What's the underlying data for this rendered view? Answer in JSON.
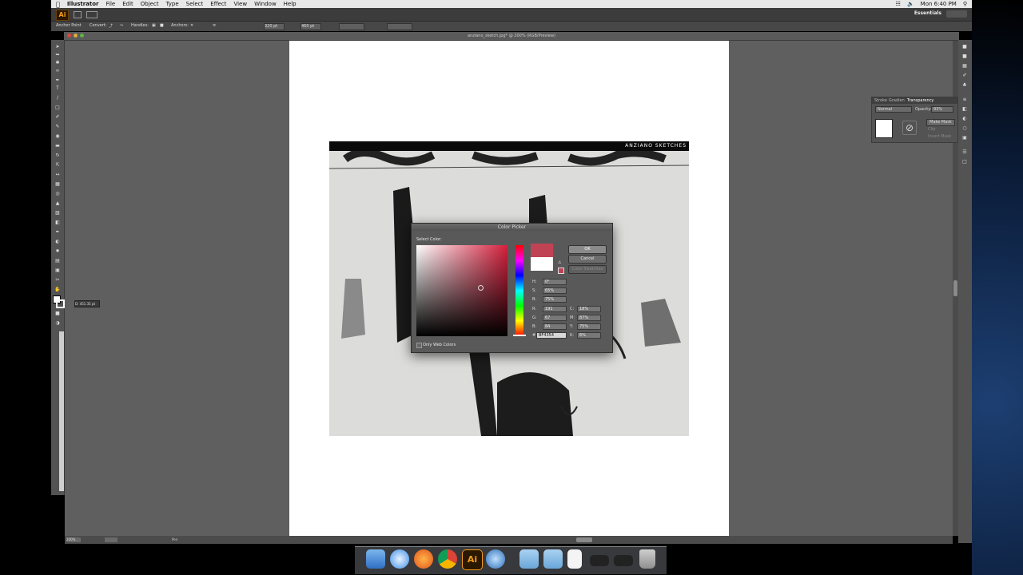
{
  "menubar": {
    "app_name": "Illustrator",
    "items": [
      "File",
      "Edit",
      "Object",
      "Type",
      "Select",
      "Effect",
      "View",
      "Window",
      "Help"
    ],
    "clock": "Mon 6:40 PM"
  },
  "appbar": {
    "logo": "Ai",
    "workspace": "Essentials"
  },
  "control_bar": {
    "tool_label": "Anchor Point",
    "convert_label": "Convert:",
    "handles_label": "Handles:",
    "anchors_label": "Anchors:",
    "x_value": "320 pt",
    "y_value": "460 pt"
  },
  "document": {
    "title": "anziano_sketch.jpg* @ 200% (RGB/Preview)",
    "zoom": "200%"
  },
  "sketch": {
    "header": "ANZIANO SKETCHES"
  },
  "coord_tooltip": "D: 451.35 pt",
  "transparency_panel": {
    "tabs": [
      "Stroke",
      "Gradien",
      "Transparency"
    ],
    "blend_mode": "Normal",
    "opacity_label": "Opacity:",
    "opacity_value": "93%",
    "make_mask": "Make Mask",
    "clip": "Clip",
    "invert_mask": "Invert Mask"
  },
  "color_picker": {
    "title": "Color Picker",
    "select_label": "Select Color:",
    "ok": "OK",
    "cancel": "Cancel",
    "swatches": "Color Swatches",
    "only_web": "Only Web Colors",
    "new_color": "#bf4354",
    "H": {
      "label": "H:",
      "value": "0°"
    },
    "S": {
      "label": "S:",
      "value": "65%"
    },
    "B": {
      "label": "B:",
      "value": "75%"
    },
    "R": {
      "label": "R:",
      "value": "191"
    },
    "G": {
      "label": "G:",
      "value": "67"
    },
    "Bl": {
      "label": "B:",
      "value": "84"
    },
    "C": {
      "label": "C:",
      "value": "18%"
    },
    "M": {
      "label": "M:",
      "value": "87%"
    },
    "Y": {
      "label": "Y:",
      "value": "75%"
    },
    "K": {
      "label": "K:",
      "value": "6%"
    },
    "hex_label": "#",
    "hex": "BF4354"
  },
  "statusbar": {
    "zoom": "200%",
    "tool": "Pen"
  },
  "dock_icons": [
    "finder-icon",
    "safari-icon",
    "firefox-icon",
    "chrome-icon",
    "illustrator-icon",
    "quicktime-icon",
    "folder-icon",
    "folder-icon",
    "document-icon",
    "terminal-icon",
    "terminal-icon",
    "trash-icon"
  ]
}
